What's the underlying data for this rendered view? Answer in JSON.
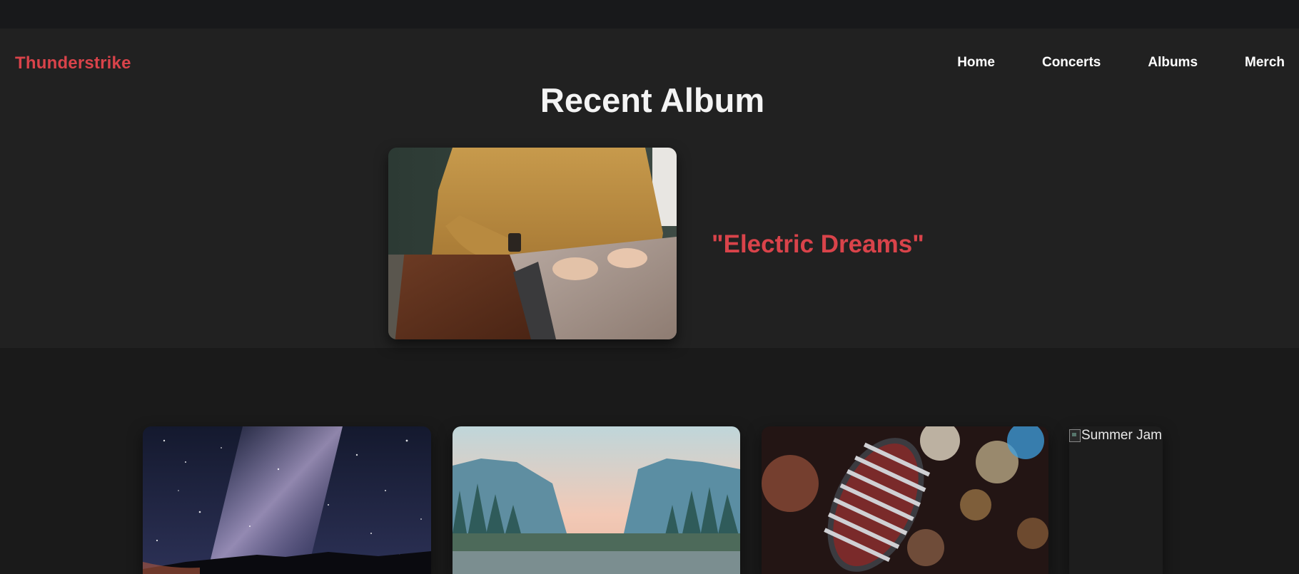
{
  "brand": {
    "name": "Thunderstrike"
  },
  "nav": {
    "items": [
      {
        "label": "Home"
      },
      {
        "label": "Concerts"
      },
      {
        "label": "Albums"
      },
      {
        "label": "Merch"
      }
    ]
  },
  "hero": {
    "title": "Recent Album",
    "album_title": "\"Electric Dreams\"",
    "cover_icon": "laptop-photo"
  },
  "albums": {
    "cards": [
      {
        "image": "milky-way-photo"
      },
      {
        "image": "mountain-lake-photo"
      },
      {
        "image": "microphone-photo"
      },
      {
        "alt": "Summer Jam"
      }
    ]
  },
  "colors": {
    "accent": "#d9434a",
    "hero_bg": "#212121",
    "page_bg": "#1a1a1a"
  }
}
